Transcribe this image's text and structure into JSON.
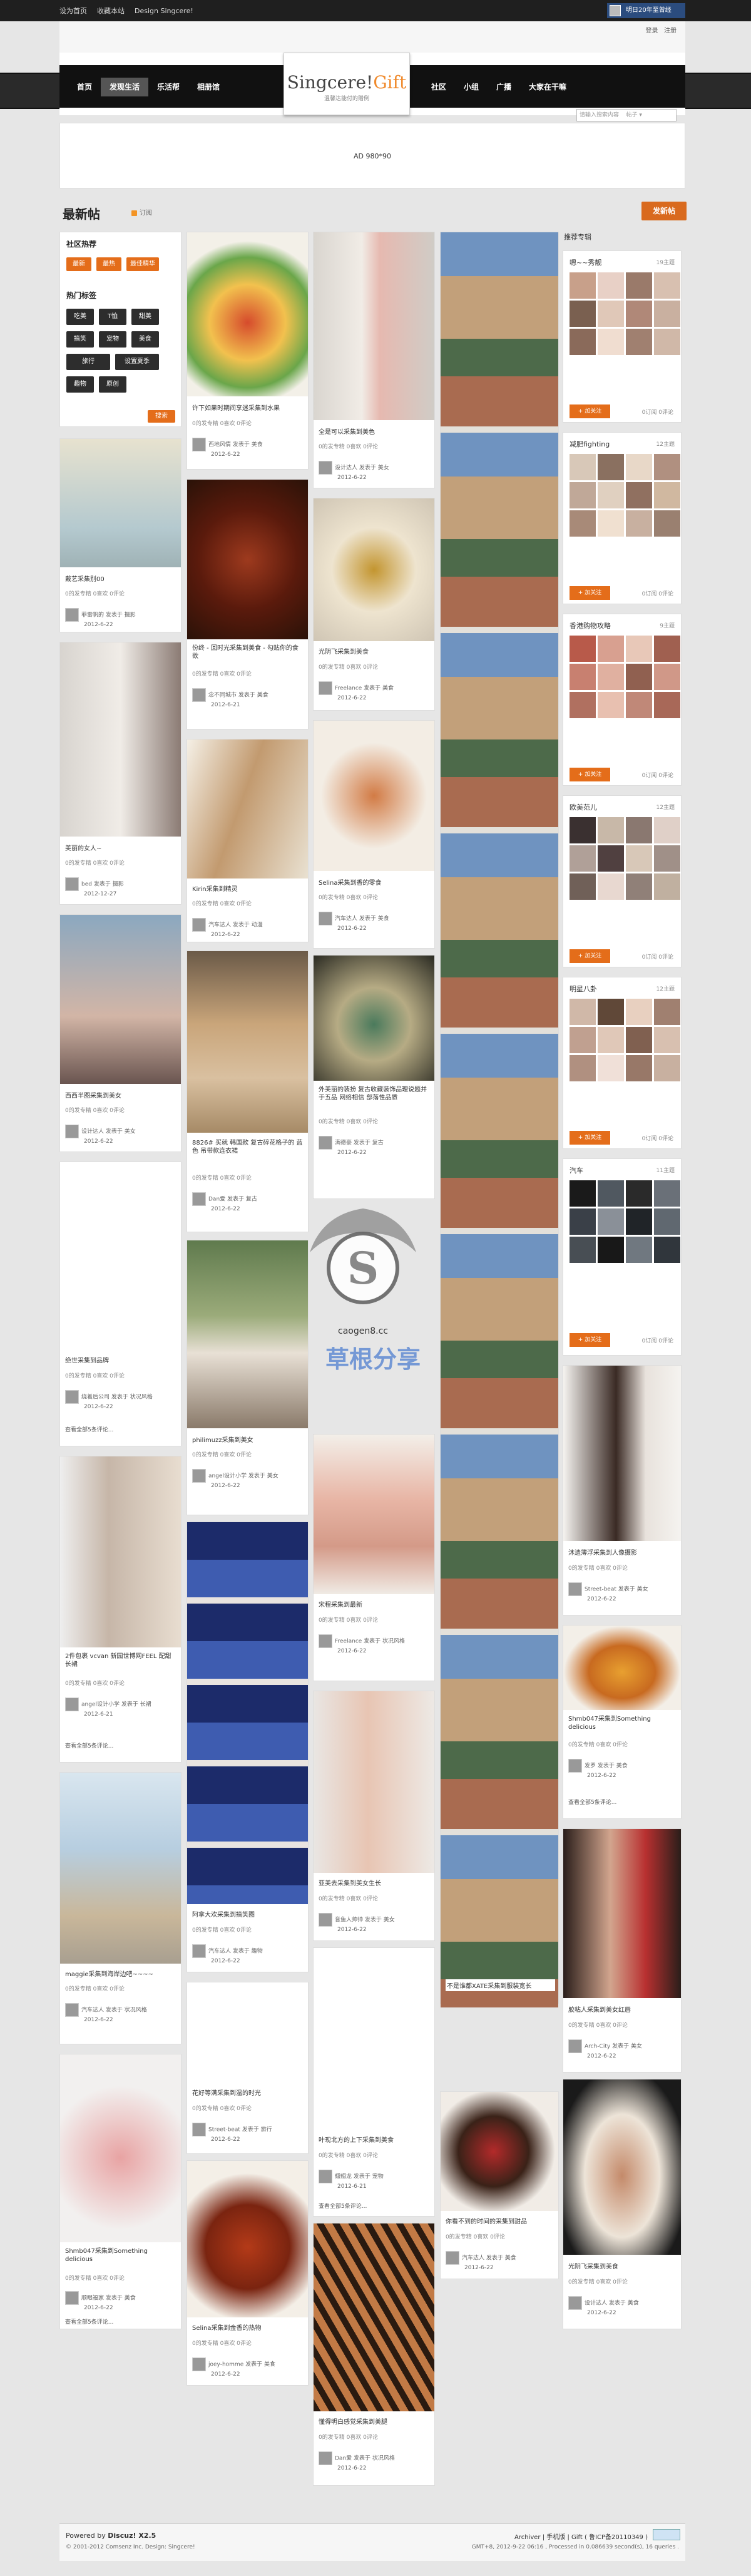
{
  "topbar": {
    "links": [
      "设为首页",
      "收藏本站",
      "Design Singcere!"
    ],
    "user": "明日20年至曾经"
  },
  "header": {
    "login": "登录",
    "register": "注册",
    "logo_main": "Singcere!",
    "logo_gift": "Gift",
    "slogan": "温馨达能付的赠例",
    "search_placeholder": "请输入搜索内容",
    "search_scope": "帖子"
  },
  "nav": {
    "left": [
      "首页",
      "发现生活",
      "乐活帮",
      "相册馆"
    ],
    "right": [
      "社区",
      "小组",
      "广播",
      "大家在干嘛"
    ]
  },
  "ad": {
    "label": "AD 980*90"
  },
  "page": {
    "title": "最新帖",
    "subtitle": "订阅",
    "post_button": "发新帖"
  },
  "tags": {
    "community_title": "社区热荐",
    "community": [
      "最新",
      "最热",
      "最佳精华"
    ],
    "hot_title": "热门标签",
    "hot": [
      "吃美",
      "T恤",
      "甜美",
      "搞笑",
      "宠物",
      "美食",
      "旅行",
      "设置夏季",
      "趣物",
      "原创"
    ],
    "search_btn": "搜索"
  },
  "recommend": {
    "title": "推荐专辑",
    "albums": [
      {
        "name": "嗯~~秀靓",
        "count": "19主题",
        "follow": "+ 加关注",
        "stats": "0订阅 0评论"
      },
      {
        "name": "减肥fighting",
        "count": "12主题",
        "follow": "+ 加关注",
        "stats": "0订阅 0评论"
      },
      {
        "name": "香港购物攻略",
        "count": "9主题",
        "follow": "+ 加关注",
        "stats": "0订阅 0评论"
      },
      {
        "name": "欧美范儿",
        "count": "12主题",
        "follow": "+ 加关注",
        "stats": "0订阅 0评论"
      },
      {
        "name": "明星八卦",
        "count": "12主题",
        "follow": "+ 加关注",
        "stats": "0订阅 0评论"
      },
      {
        "name": "汽车",
        "count": "11主题",
        "follow": "+ 加关注",
        "stats": "0订阅 0评论"
      }
    ]
  },
  "cards": [
    {
      "title": "戴艺采集别00",
      "stats": "0的发专精 0喜欢 0评论",
      "user": "菲雷帆的",
      "cat": "摄影",
      "date": "2012-6-22"
    },
    {
      "title": "美丽的女人~",
      "stats": "0的发专精 0喜欢 0评论",
      "user": "bed",
      "cat": "摄影",
      "date": "2012-12-27"
    },
    {
      "title": "西西半图采集到美女",
      "stats": "0的发专精 0喜欢 0评论",
      "user": "设计达人",
      "cat": "美女",
      "date": "2012-6-22"
    },
    {
      "title": "绝世采集到品牌",
      "stats": "0的发专精 0喜欢 0评论",
      "user": "绕着后公司",
      "cat": "状况风格",
      "date": "2012-6-22"
    },
    {
      "title": "2件包裹 vcvan 新园世博网FEEL 配甜长裙",
      "stats": "0的发专精 0喜欢 0评论",
      "user": "angel设计小学",
      "cat": "长裙",
      "date": "2012-6-21"
    },
    {
      "title": "maggie采集到海岸边吧~~~~",
      "stats": "0的发专精 0喜欢 0评论",
      "user": "汽车达人",
      "cat": "状况风格",
      "date": "2012-6-22"
    },
    {
      "title": "Shmb047采集到Something delicious",
      "stats": "0的发专精 0喜欢 0评论",
      "user": "顺眼福家",
      "cat": "美食",
      "date": "2012-6-22"
    },
    {
      "title": "许下如果时期间享迷采集到水果",
      "stats": "0的发专精 0喜欢 0评论",
      "user": "西地风情",
      "cat": "美食",
      "date": "2012-6-22"
    },
    {
      "title": "份终 - 回时光采集到美食 - 勾贴你的食欲",
      "stats": "0的发专精 0喜欢 0评论",
      "user": "念不同城市",
      "cat": "美食",
      "date": "2012-6-21"
    },
    {
      "title": "Kirin采集到精灵",
      "stats": "0的发专精 0喜欢 0评论",
      "user": "汽车达人",
      "cat": "动漫",
      "date": "2012-6-22"
    },
    {
      "title": "8826# 买就 韩国款 复古碎花格子的 蓝色 吊带款连衣裙",
      "stats": "0的发专精 0喜欢 0评论",
      "user": "Dan爱",
      "cat": "复古",
      "date": "2012-6-22"
    },
    {
      "title": "philimuzz采集到美女",
      "stats": "0的发专精 0喜欢 0评论",
      "user": "angel设计小学",
      "cat": "美女",
      "date": "2012-6-22"
    },
    {
      "title": "阿拿大欢采集到搞笑图",
      "stats": "0的发专精 0喜欢 0评论",
      "user": "汽车达人",
      "cat": "趣物",
      "date": "2012-6-22"
    },
    {
      "title": "花好等满采集到温的时光",
      "stats": "0的发专精 0喜欢 0评论",
      "user": "Street-beat",
      "cat": "旅行",
      "date": "2012-6-22"
    },
    {
      "title": "Selina采集到金香的热物",
      "stats": "0的发专精 0喜欢 0评论",
      "user": "joey-homme",
      "cat": "美食",
      "date": "2012-6-22"
    },
    {
      "title": "全是可以采集到美色",
      "stats": "0的发专精 0喜欢 0评论",
      "user": "设计达人",
      "cat": "美女",
      "date": "2012-6-22"
    },
    {
      "title": "光阴飞采集到美食",
      "stats": "0的发专精 0喜欢 0评论",
      "user": "Freelance",
      "cat": "美食",
      "date": "2012-6-22"
    },
    {
      "title": "Selina采集到香的零食",
      "stats": "0的发专精 0喜欢 0评论",
      "user": "汽车达人",
      "cat": "美食",
      "date": "2012-6-22"
    },
    {
      "title": "外美丽的装扮 复古收藏装饰品理说题并于五品 网络相信 部落性品质",
      "stats": "0的发专精 0喜欢 0评论",
      "user": "满德豪",
      "cat": "复古",
      "date": "2012-6-22"
    },
    {
      "title": "宋程采集到最新",
      "stats": "0的发专精 0喜欢 0评论",
      "user": "Freelance",
      "cat": "状况风格",
      "date": "2012-6-22"
    },
    {
      "title": "亚美去采集到美女生长",
      "stats": "0的发专精 0喜欢 0评论",
      "user": "音鱼人帅帅",
      "cat": "美女",
      "date": "2012-6-22"
    },
    {
      "title": "叶现北方的上下采集到美食",
      "stats": "0的发专精 0喜欢 0评论",
      "user": "翅翅龙",
      "cat": "宠物",
      "date": "2012-6-21"
    },
    {
      "title": "懂得明白感觉采集到美腿",
      "stats": "0的发专精 0喜欢 0评论",
      "user": "Dan爱",
      "cat": "状况风格",
      "date": "2012-6-22"
    },
    {
      "title": "不是谁都XATE采集到服装宽长",
      "stats": "0的发专精 0喜欢 0评论",
      "user": "原来风情",
      "cat": "旅行",
      "date": "2012-6-22"
    },
    {
      "title": "你看不到的时间的采集到甜品",
      "stats": "0的发专精 0喜欢 0评论",
      "user": "汽车达人",
      "cat": "美食",
      "date": "2012-6-22"
    },
    {
      "title": "沐遗薄浮采集到人像摄影",
      "stats": "0的发专精 0喜欢 0评论",
      "user": "Street-beat",
      "cat": "美女",
      "date": "2012-6-22"
    },
    {
      "title": "Shmb047采集到Something delicious",
      "stats": "0的发专精 0喜欢 0评论",
      "user": "发罗",
      "cat": "美食",
      "date": "2012-6-22"
    },
    {
      "title": "胶粘人采集到美女红唇",
      "stats": "0的发专精 0喜欢 0评论",
      "user": "Arch-City",
      "cat": "美女",
      "date": "2012-6-22"
    },
    {
      "title": "光阴飞采集到美食",
      "stats": "0的发专精 0喜欢 0评论",
      "user": "设计达人",
      "cat": "美食",
      "date": "2012-6-22"
    }
  ],
  "view_all": "查看全部5条评论...",
  "footer": {
    "powered": "Powered by",
    "discuz": "Discuz! X2.5",
    "copy": "© 2001-2012 Comsenz Inc. Design: Singcere!",
    "links": "Archiver | 手机版 | Gift ( 鲁ICP备20110349 )",
    "time": "GMT+8, 2012-9-22 06:16 , Processed in 0.086639 second(s), 16 queries ."
  },
  "watermark": {
    "text": "草根分享",
    "url": "caogen8.cc"
  },
  "colors": {
    "accent": "#e46d1a",
    "dark": "#1f1f1f",
    "link": "#2b4c7e"
  }
}
